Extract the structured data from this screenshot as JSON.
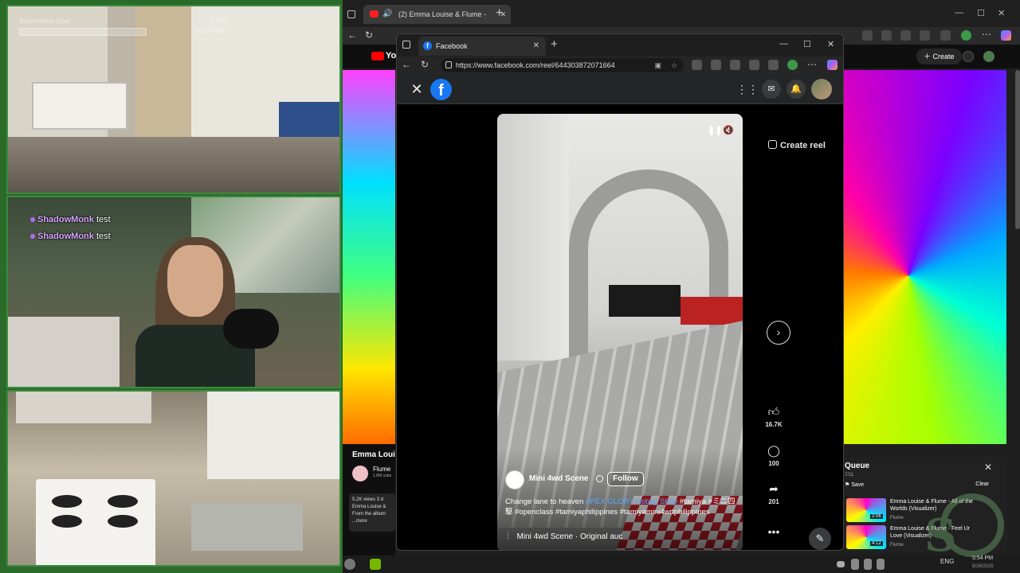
{
  "overlay": {
    "sub_goal_label": "Subscription Goal",
    "sub_goal_count": "0 / 10",
    "sub_goal_sublabel": "Sub Points",
    "chat": [
      {
        "user": "ShadowMonk",
        "message": "test"
      },
      {
        "user": "ShadowMonk",
        "message": "test"
      }
    ]
  },
  "bg_browser": {
    "tab_title": "(2) Emma Louise & Flume -",
    "youtube_label": "You",
    "create_label": "Create",
    "below_video": {
      "title": "Emma Loui",
      "channel": "Flume",
      "subscribers": "1.8M subs",
      "description": "5.2K views  3 d\nEmma Louise &\nFrom the album\n...more"
    },
    "queue": {
      "title": "Queue",
      "count": "7/11",
      "save_label": "Save",
      "clear_label": "Clear",
      "items": [
        {
          "title": "Emma Louise & Flume - All of the Worlds (Visualizer)",
          "channel": "Flume",
          "duration": "2:06"
        },
        {
          "title": "Emma Louise & Flume - Feel Ur Love (Visualizer)",
          "channel": "Flume",
          "duration": "4:12"
        }
      ]
    }
  },
  "taskbar": {
    "lang": "ENG",
    "time": "5:54 PM",
    "date": "8/26/2025"
  },
  "fb_window": {
    "tab_title": "Facebook",
    "url": "https://www.facebook.com/reel/644303872071664",
    "logo_letter": "f",
    "create_reel_label": "Create reel",
    "reel": {
      "author": "Mini 4wd Scene",
      "follow_label": "Follow",
      "caption_text": "Change lane to heaven ",
      "caption_link": "APEX GLORY Hobby Shop",
      "caption_tags": " #tamiya #ミニ四駆 #openclass #tamiyaphilippines #tamiyamini4wdphilippines",
      "audio": "Mini 4wd Scene · Original auc"
    },
    "actions": {
      "likes": "16.7K",
      "comments": "100",
      "shares": "201"
    }
  }
}
